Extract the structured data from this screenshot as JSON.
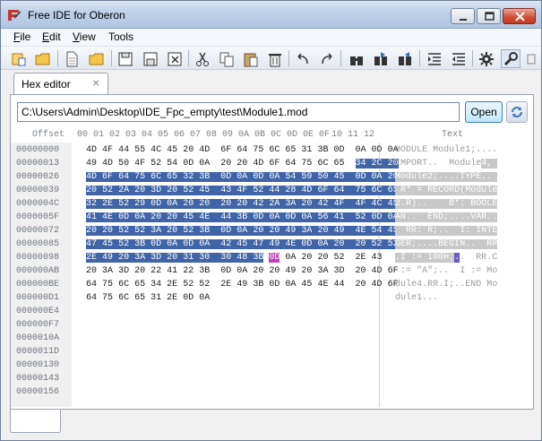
{
  "window": {
    "title": "Free IDE for Oberon",
    "close_color": "#c23a1f"
  },
  "menu": [
    "File",
    "Edit",
    "View",
    "Tools"
  ],
  "toolbar_icons": [
    "new-project-icon",
    "open-folder-icon",
    "new-file-icon",
    "open-file-icon",
    "save-icon",
    "save-as-icon",
    "close-file-icon",
    "cut-icon",
    "copy-icon",
    "paste-icon",
    "delete-icon",
    "undo-icon",
    "redo-icon",
    "find-icon",
    "find-next-icon",
    "find-prev-icon",
    "indent-icon",
    "unindent-icon",
    "settings-icon",
    "build-icon"
  ],
  "tab": {
    "label": "Hex editor",
    "close": "×"
  },
  "path": {
    "value": "C:\\Users\\Admin\\Desktop\\IDE_Fpc_empty\\test\\Module1.mod",
    "open_label": "Open"
  },
  "hex": {
    "offset_header": "Offset",
    "hex_header_a": "00 01 02 03 04 05 06 07",
    "hex_header_b": "08 09 0A 0B 0C 0D 0E 0F",
    "hex_header_c": "10 11 12",
    "text_header": "Text",
    "offsets": [
      "00000000",
      "00000013",
      "00000026",
      "00000039",
      "0000004C",
      "0000005F",
      "00000072",
      "00000085",
      "00000098",
      "000000AB",
      "000000BE",
      "000000D1",
      "000000E4",
      "000000F7",
      "0000010A",
      "0000011D",
      "00000130",
      "00000143",
      "00000156"
    ],
    "rows": [
      {
        "hex": "4D 4F 44 55 4C 45 20 4D  6F 64 75 6C 65 31 3B 0D  0A 0D 0A",
        "text": "MODULE Module1;...."
      },
      {
        "hex": "49 4D 50 4F 52 54 0D 0A  20 20 4D 6F 64 75 6C 65  34 2C 20",
        "text": "IMPORT..  Module4, "
      },
      {
        "hex": "4D 6F 64 75 6C 65 32 3B  0D 0A 0D 0A 54 59 50 45  0D 0A 20",
        "text": "Module2;....TYPE.. "
      },
      {
        "hex": "20 52 2A 20 3D 20 52 45  43 4F 52 44 28 4D 6F 64  75 6C 65",
        "text": " R* = RECORD(Module"
      },
      {
        "hex": "32 2E 52 29 0D 0A 20 20  20 20 42 2A 3A 20 42 4F  4F 4C 45",
        "text": "2.R)..    B*: BOOLE"
      },
      {
        "hex": "41 4E 0D 0A 20 20 45 4E  44 3B 0D 0A 0D 0A 56 41  52 0D 0A",
        "text": "AN..  END;....VAR.."
      },
      {
        "hex": "20 20 52 52 3A 20 52 3B  0D 0A 20 20 49 3A 20 49  4E 54 45",
        "text": "  RR: R;..  I: INTE"
      },
      {
        "hex": "47 45 52 3B 0D 0A 0D 0A  42 45 47 49 4E 0D 0A 20  20 52 52",
        "text": "GER;....BEGIN..  RR"
      },
      {
        "hex": "2E 49 20 3A 3D 20 31 30  30 48 3B 0D 0A 20 20 52  2E 43 ",
        "text": ".I := 100H;..  RR.C"
      },
      {
        "hex": "20 3A 3D 20 22 41 22 3B  0D 0A 20 20 49 20 3A 3D  20 4D 6F",
        "text": " := \"A\";..  I := Mo"
      },
      {
        "hex": "64 75 6C 65 34 2E 52 52  2E 49 3B 0D 0A 45 4E 44  20 4D 6F",
        "text": "dule4.RR.I;..END Mo"
      },
      {
        "hex": "64 75 6C 65 31 2E 0D 0A",
        "text": "dule1..."
      }
    ]
  },
  "colors": {
    "selection": "#3f64a8",
    "cursor": "#c73fb8"
  }
}
